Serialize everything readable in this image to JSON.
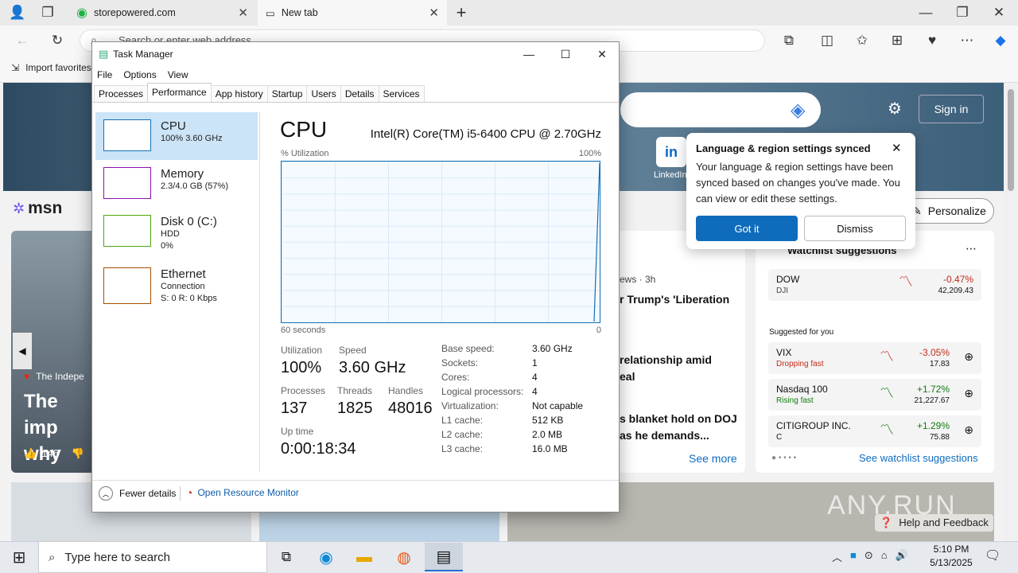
{
  "browser": {
    "tabs": [
      {
        "label": "storepowered.com"
      },
      {
        "label": "New tab"
      }
    ],
    "address_placeholder": "Search or enter web address",
    "bookmark": "Import favorites"
  },
  "msn": {
    "logo": "msn",
    "sign_in": "Sign in",
    "linkedin": "LinkedIn",
    "personalize": "Personalize",
    "hero_source": "The Indepe",
    "hero_title_1": "The imp",
    "hero_title_2": "why",
    "likes": "146",
    "news_meta": "ews · 3h",
    "news1": "r Trump's 'Liberation",
    "news2a": "relationship amid",
    "news2b": "eal",
    "news3a": "s blanket hold on DOJ",
    "news3b": "as he demands...",
    "see_more": "See more",
    "watchlist_title": "Watchlist suggestions",
    "suggested_label": "Suggested for you",
    "stocks": [
      {
        "name": "DOW",
        "sub": "DJI",
        "change": "-0.47%",
        "price": "42,209.43",
        "color": "#c42b1c"
      },
      {
        "name": "VIX",
        "sub": "Dropping fast",
        "change": "-3.05%",
        "price": "17.83",
        "color": "#c42b1c"
      },
      {
        "name": "Nasdaq 100",
        "sub": "Rising fast",
        "change": "+1.72%",
        "price": "21,227.67",
        "color": "#107c10"
      },
      {
        "name": "CITIGROUP INC.",
        "sub": "C",
        "change": "+1.29%",
        "price": "75.88",
        "color": "#107c10"
      }
    ],
    "see_watchlist": "See watchlist suggestions",
    "help": "Help and Feedback",
    "watermark": "ANY.RUN"
  },
  "popup": {
    "title": "Language & region settings synced",
    "body": "Your language & region settings have been synced based on changes you've made. You can view or edit these settings.",
    "got_it": "Got it",
    "dismiss": "Dismiss"
  },
  "taskmgr": {
    "title": "Task Manager",
    "menu": [
      "File",
      "Options",
      "View"
    ],
    "tabs": [
      "Processes",
      "Performance",
      "App history",
      "Startup",
      "Users",
      "Details",
      "Services"
    ],
    "resources": [
      {
        "name": "CPU",
        "l1": "100%  3.60 GHz",
        "l2": "",
        "color": "#1170b8"
      },
      {
        "name": "Memory",
        "l1": "2.3/4.0 GB (57%)",
        "l2": "",
        "color": "#8b12ae"
      },
      {
        "name": "Disk 0 (C:)",
        "l1": "HDD",
        "l2": "0%",
        "color": "#4da60c"
      },
      {
        "name": "Ethernet",
        "l1": "Connection",
        "l2": "S: 0 R: 0 Kbps",
        "color": "#a74f01"
      }
    ],
    "heading": "CPU",
    "cpu_model": "Intel(R) Core(TM) i5-6400 CPU @ 2.70GHz",
    "util_label": "% Utilization",
    "util_max": "100%",
    "time_label": "60 seconds",
    "time_zero": "0",
    "utilization_label": "Utilization",
    "utilization": "100%",
    "speed_label": "Speed",
    "speed": "3.60 GHz",
    "processes_label": "Processes",
    "processes": "137",
    "threads_label": "Threads",
    "threads": "1825",
    "handles_label": "Handles",
    "handles": "48016",
    "uptime_label": "Up time",
    "uptime": "0:00:18:34",
    "specs": [
      {
        "k": "Base speed:",
        "v": "3.60 GHz"
      },
      {
        "k": "Sockets:",
        "v": "1"
      },
      {
        "k": "Cores:",
        "v": "4"
      },
      {
        "k": "Logical processors:",
        "v": "4"
      },
      {
        "k": "Virtualization:",
        "v": "Not capable"
      },
      {
        "k": "L1 cache:",
        "v": "512 KB"
      },
      {
        "k": "L2 cache:",
        "v": "2.0 MB"
      },
      {
        "k": "L3 cache:",
        "v": "16.0 MB"
      }
    ],
    "fewer_details": "Fewer details",
    "resource_monitor": "Open Resource Monitor"
  },
  "taskbar": {
    "search_placeholder": "Type here to search",
    "time": "5:10 PM",
    "date": "5/13/2025"
  }
}
